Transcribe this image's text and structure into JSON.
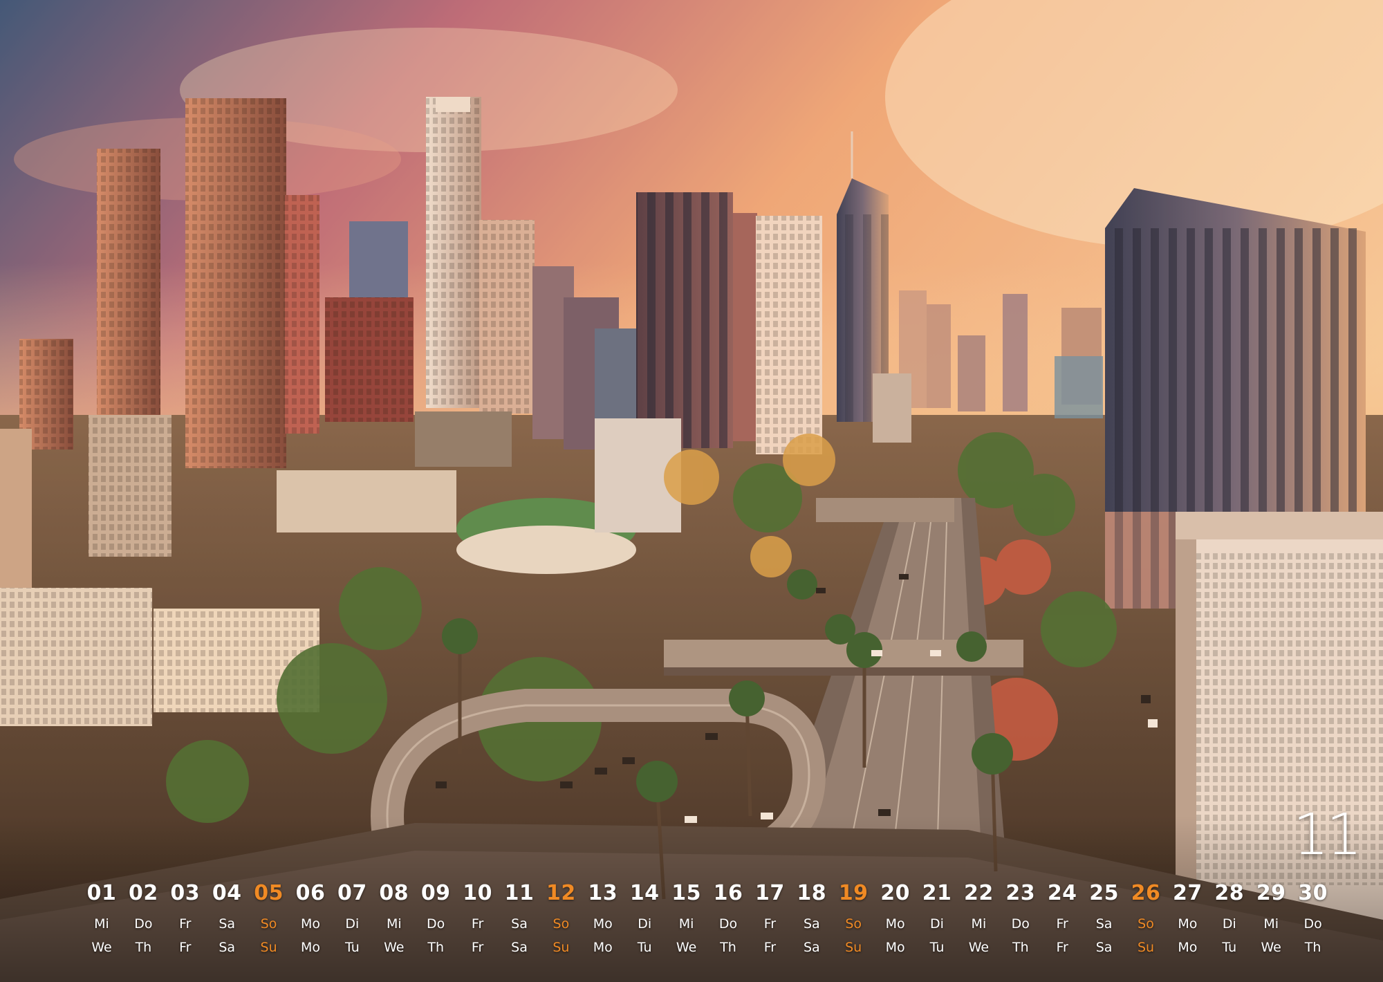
{
  "month": "11",
  "colors": {
    "sunday_accent": "#f08a24",
    "text": "#ffffff"
  },
  "days": [
    {
      "num": "01",
      "de": "Mi",
      "en": "We",
      "sunday": false
    },
    {
      "num": "02",
      "de": "Do",
      "en": "Th",
      "sunday": false
    },
    {
      "num": "03",
      "de": "Fr",
      "en": "Fr",
      "sunday": false
    },
    {
      "num": "04",
      "de": "Sa",
      "en": "Sa",
      "sunday": false
    },
    {
      "num": "05",
      "de": "So",
      "en": "Su",
      "sunday": true
    },
    {
      "num": "06",
      "de": "Mo",
      "en": "Mo",
      "sunday": false
    },
    {
      "num": "07",
      "de": "Di",
      "en": "Tu",
      "sunday": false
    },
    {
      "num": "08",
      "de": "Mi",
      "en": "We",
      "sunday": false
    },
    {
      "num": "09",
      "de": "Do",
      "en": "Th",
      "sunday": false
    },
    {
      "num": "10",
      "de": "Fr",
      "en": "Fr",
      "sunday": false
    },
    {
      "num": "11",
      "de": "Sa",
      "en": "Sa",
      "sunday": false
    },
    {
      "num": "12",
      "de": "So",
      "en": "Su",
      "sunday": true
    },
    {
      "num": "13",
      "de": "Mo",
      "en": "Mo",
      "sunday": false
    },
    {
      "num": "14",
      "de": "Di",
      "en": "Tu",
      "sunday": false
    },
    {
      "num": "15",
      "de": "Mi",
      "en": "We",
      "sunday": false
    },
    {
      "num": "16",
      "de": "Do",
      "en": "Th",
      "sunday": false
    },
    {
      "num": "17",
      "de": "Fr",
      "en": "Fr",
      "sunday": false
    },
    {
      "num": "18",
      "de": "Sa",
      "en": "Sa",
      "sunday": false
    },
    {
      "num": "19",
      "de": "So",
      "en": "Su",
      "sunday": true
    },
    {
      "num": "20",
      "de": "Mo",
      "en": "Mo",
      "sunday": false
    },
    {
      "num": "21",
      "de": "Di",
      "en": "Tu",
      "sunday": false
    },
    {
      "num": "22",
      "de": "Mi",
      "en": "We",
      "sunday": false
    },
    {
      "num": "23",
      "de": "Do",
      "en": "Th",
      "sunday": false
    },
    {
      "num": "24",
      "de": "Fr",
      "en": "Fr",
      "sunday": false
    },
    {
      "num": "25",
      "de": "Sa",
      "en": "Sa",
      "sunday": false
    },
    {
      "num": "26",
      "de": "So",
      "en": "Su",
      "sunday": true
    },
    {
      "num": "27",
      "de": "Mo",
      "en": "Mo",
      "sunday": false
    },
    {
      "num": "28",
      "de": "Di",
      "en": "Tu",
      "sunday": false
    },
    {
      "num": "29",
      "de": "Mi",
      "en": "We",
      "sunday": false
    },
    {
      "num": "30",
      "de": "Do",
      "en": "Th",
      "sunday": false
    }
  ]
}
